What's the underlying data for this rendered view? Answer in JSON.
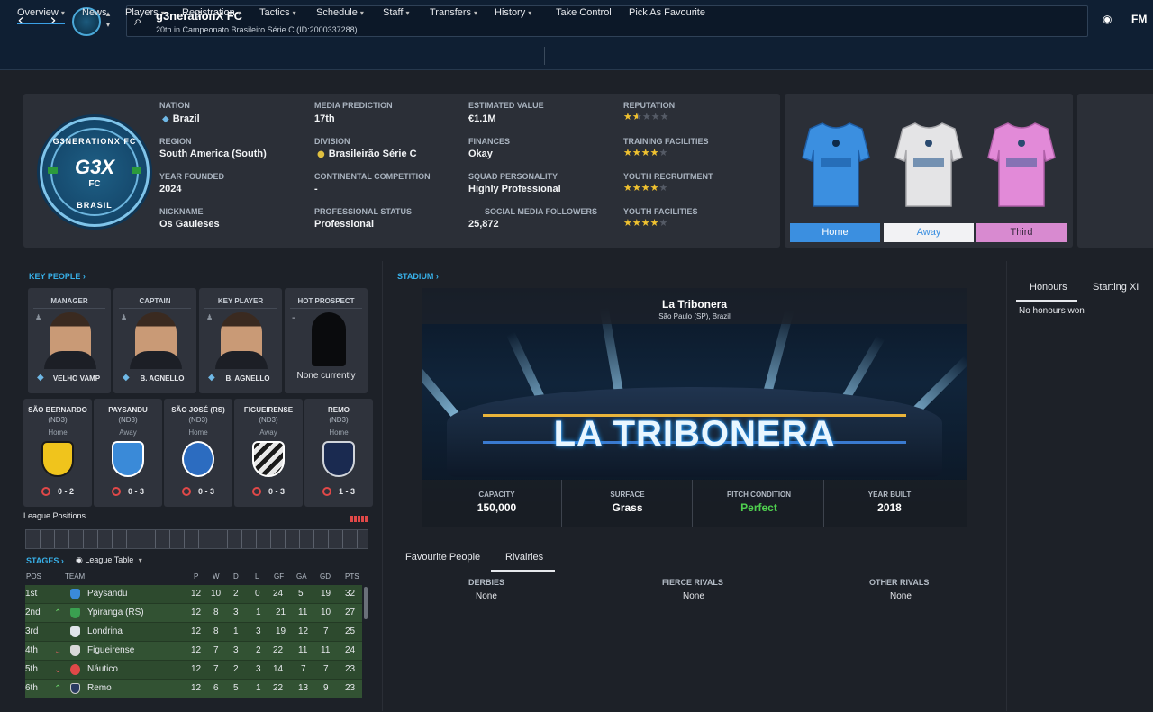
{
  "header": {
    "club_name": "g3nerationX FC",
    "subtitle": "20th in Campeonato Brasileiro Série C (ID:2000337288)",
    "right_logo": "FM"
  },
  "menu": {
    "items": [
      "Overview",
      "News",
      "Players",
      "Registration",
      "Tactics",
      "Schedule",
      "Staff",
      "Transfers",
      "History",
      "Take Control",
      "Pick As Favourite"
    ]
  },
  "crest": {
    "top_text": "G3NERATIONX FC",
    "main": "G3X",
    "fc": "FC",
    "bottom_text": "BRASIL"
  },
  "info": {
    "nation_label": "NATION",
    "nation": "Brazil",
    "region_label": "REGION",
    "region": "South America (South)",
    "founded_label": "YEAR FOUNDED",
    "founded": "2024",
    "nickname_label": "NICKNAME",
    "nickname": "Os Gauleses",
    "media_label": "MEDIA PREDICTION",
    "media": "17th",
    "division_label": "DIVISION",
    "division": "Brasileirão Série C",
    "continental_label": "CONTINENTAL COMPETITION",
    "continental": "-",
    "status_label": "PROFESSIONAL STATUS",
    "status": "Professional",
    "value_label": "ESTIMATED VALUE",
    "value": "€1.1M",
    "finances_label": "FINANCES",
    "finances": "Okay",
    "personality_label": "SQUAD PERSONALITY",
    "personality": "Highly Professional",
    "social_label": "SOCIAL MEDIA FOLLOWERS",
    "social": "25,872",
    "reputation_label": "REPUTATION",
    "reputation_stars": 1.5,
    "training_label": "TRAINING FACILITIES",
    "training_stars": 4,
    "recruitment_label": "YOUTH RECRUITMENT",
    "recruitment_stars": 4,
    "youth_label": "YOUTH FACILITIES",
    "youth_stars": 4
  },
  "kits": {
    "home": "Home",
    "away": "Away",
    "third": "Third",
    "home_color": "#3b8fe0",
    "away_color": "#e4e4e6",
    "third_color": "#e28ad8"
  },
  "key_people": {
    "title": "KEY PEOPLE",
    "cards": [
      {
        "role": "MANAGER",
        "name": "VELHO VAMP"
      },
      {
        "role": "CAPTAIN",
        "name": "B. AGNELLO"
      },
      {
        "role": "KEY PLAYER",
        "name": "B. AGNELLO"
      },
      {
        "role": "HOT PROSPECT",
        "name": "None currently",
        "dash": "-"
      }
    ]
  },
  "fixtures": [
    {
      "team": "SÃO BERNARDO",
      "div": "(ND3)",
      "venue": "Home",
      "score": "0 - 2",
      "color": "#f0c41c"
    },
    {
      "team": "PAYSANDU",
      "div": "(ND3)",
      "venue": "Away",
      "score": "0 - 3",
      "color": "#3a8ad8"
    },
    {
      "team": "SÃO JOSÉ (RS)",
      "div": "(ND3)",
      "venue": "Home",
      "score": "0 - 3",
      "color": "#2c6cc0"
    },
    {
      "team": "FIGUEIRENSE",
      "div": "(ND3)",
      "venue": "Away",
      "score": "0 - 3",
      "color": "#d8d8d8"
    },
    {
      "team": "REMO",
      "div": "(ND3)",
      "venue": "Home",
      "score": "1 - 3",
      "color": "#1a2a50"
    }
  ],
  "league_positions": {
    "label": "League Positions"
  },
  "stages": {
    "title": "STAGES",
    "dropdown": "League Table"
  },
  "table": {
    "headers": [
      "POS",
      "TEAM",
      "P",
      "W",
      "D",
      "L",
      "GF",
      "GA",
      "GD",
      "PTS"
    ],
    "rows": [
      {
        "pos": "1st",
        "team": "Paysandu",
        "p": "12",
        "w": "10",
        "d": "2",
        "l": "0",
        "gf": "24",
        "ga": "5",
        "gd": "19",
        "pts": "32",
        "move": "",
        "color": "#3a8ad8"
      },
      {
        "pos": "2nd",
        "team": "Ypiranga (RS)",
        "p": "12",
        "w": "8",
        "d": "3",
        "l": "1",
        "gf": "21",
        "ga": "11",
        "gd": "10",
        "pts": "27",
        "move": "up",
        "color": "#3aa050"
      },
      {
        "pos": "3rd",
        "team": "Londrina",
        "p": "12",
        "w": "8",
        "d": "1",
        "l": "3",
        "gf": "19",
        "ga": "12",
        "gd": "7",
        "pts": "25",
        "move": "",
        "color": "#e0e4ea"
      },
      {
        "pos": "4th",
        "team": "Figueirense",
        "p": "12",
        "w": "7",
        "d": "3",
        "l": "2",
        "gf": "22",
        "ga": "11",
        "gd": "11",
        "pts": "24",
        "move": "down",
        "color": "#d8d8d8"
      },
      {
        "pos": "5th",
        "team": "Náutico",
        "p": "12",
        "w": "7",
        "d": "2",
        "l": "3",
        "gf": "14",
        "ga": "7",
        "gd": "7",
        "pts": "23",
        "move": "down",
        "color": "#e04848"
      },
      {
        "pos": "6th",
        "team": "Remo",
        "p": "12",
        "w": "6",
        "d": "5",
        "l": "1",
        "gf": "22",
        "ga": "13",
        "gd": "9",
        "pts": "23",
        "move": "up",
        "color": "#2a3a60"
      }
    ]
  },
  "stadium": {
    "title": "STADIUM",
    "name": "La Tribonera",
    "location": "São Paulo (SP), Brazil",
    "sign": "LA TRIBONERA",
    "capacity_label": "CAPACITY",
    "capacity": "150,000",
    "surface_label": "SURFACE",
    "surface": "Grass",
    "pitch_label": "PITCH CONDITION",
    "pitch": "Perfect",
    "built_label": "YEAR BUILT",
    "built": "2018"
  },
  "lower_tabs": {
    "favourite": "Favourite People",
    "rivalries": "Rivalries"
  },
  "rivals": {
    "derbies_label": "DERBIES",
    "derbies": "None",
    "fierce_label": "FIERCE RIVALS",
    "fierce": "None",
    "other_label": "OTHER RIVALS",
    "other": "None"
  },
  "honours": {
    "tab1": "Honours",
    "tab2": "Starting XI",
    "text": "No honours won"
  }
}
